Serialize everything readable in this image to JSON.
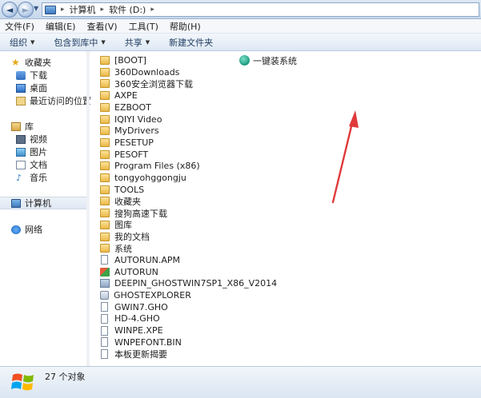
{
  "address": {
    "crumbs": [
      "计算机",
      "软件 (D:)"
    ],
    "back_glyph": "◄",
    "forward_glyph": "►"
  },
  "menu": [
    "文件(F)",
    "编辑(E)",
    "查看(V)",
    "工具(T)",
    "帮助(H)"
  ],
  "toolbar": {
    "organize": "组织",
    "include_library": "包含到库中",
    "share": "共享",
    "new_folder": "新建文件夹"
  },
  "nav": {
    "favorites": "收藏夹",
    "downloads": "下载",
    "desktop": "桌面",
    "recent": "最近访问的位置",
    "libraries": "库",
    "videos": "视频",
    "pictures": "图片",
    "documents": "文档",
    "music": "音乐",
    "computer": "计算机",
    "network": "网络"
  },
  "files": [
    {
      "name": "[BOOT]",
      "icon": "folder-icon"
    },
    {
      "name": "360Downloads",
      "icon": "folder-icon"
    },
    {
      "name": "360安全浏览器下载",
      "icon": "folder-icon"
    },
    {
      "name": "AXPE",
      "icon": "folder-icon"
    },
    {
      "name": "EZBOOT",
      "icon": "folder-icon"
    },
    {
      "name": "IQIYI Video",
      "icon": "folder-icon"
    },
    {
      "name": "MyDrivers",
      "icon": "folder-icon"
    },
    {
      "name": "PESETUP",
      "icon": "folder-icon"
    },
    {
      "name": "PESOFT",
      "icon": "folder-icon"
    },
    {
      "name": "Program Files (x86)",
      "icon": "folder-icon"
    },
    {
      "name": "tongyohggongju",
      "icon": "folder-icon"
    },
    {
      "name": "TOOLS",
      "icon": "folder-icon"
    },
    {
      "name": "收藏夹",
      "icon": "folder-icon"
    },
    {
      "name": "搜狗高速下载",
      "icon": "folder-icon"
    },
    {
      "name": "图库",
      "icon": "folder-icon"
    },
    {
      "name": "我的文档",
      "icon": "folder-icon"
    },
    {
      "name": "系统",
      "icon": "folder-icon"
    },
    {
      "name": "AUTORUN.APM",
      "icon": "document-icon"
    },
    {
      "name": "AUTORUN",
      "icon": "setup-icon"
    },
    {
      "name": "DEEPIN_GHOSTWIN7SP1_X86_V2014",
      "icon": "application-icon"
    },
    {
      "name": "GHOSTEXPLORER",
      "icon": "executable-icon"
    },
    {
      "name": "GWIN7.GHO",
      "icon": "document-icon"
    },
    {
      "name": "HD-4.GHO",
      "icon": "document-icon"
    },
    {
      "name": "WINPE.XPE",
      "icon": "document-icon"
    },
    {
      "name": "WNPEFONT.BIN",
      "icon": "document-icon"
    },
    {
      "name": "本板更新揭要",
      "icon": "document-icon"
    }
  ],
  "highlighted_file": {
    "name": "一键装系统",
    "icon": "installer-icon"
  },
  "status": {
    "count": "27 个对象"
  },
  "colors": {
    "annotation_arrow": "#e0393b",
    "accent": "#2f6fc0"
  }
}
